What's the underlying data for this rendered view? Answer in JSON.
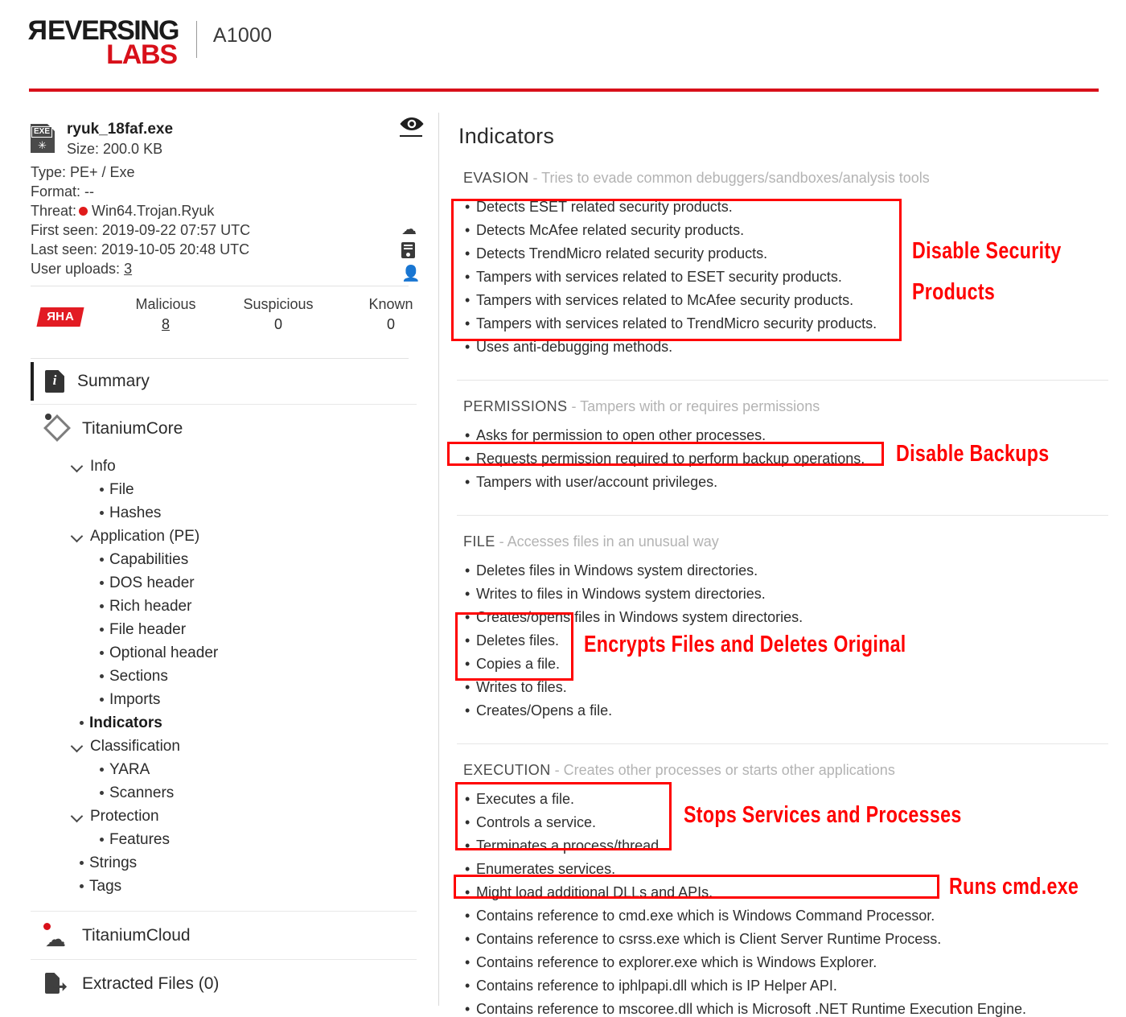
{
  "header": {
    "brand_primary": "REVERSING",
    "brand_secondary": "LABS",
    "product": "A1000",
    "accent_color": "#D8101A"
  },
  "file": {
    "name": "ryuk_18faf.exe",
    "size": "Size: 200.0 KB",
    "icon_label": "EXE",
    "type": "Type: PE+ / Exe",
    "format": "Format: --",
    "threat_label": "Threat:",
    "threat_value": "Win64.Trojan.Ryuk",
    "threat_color": "#E01B1B",
    "first_seen": "First seen: 2019-09-22 07:57 UTC",
    "last_seen": "Last seen: 2019-10-05 20:48 UTC",
    "user_uploads_label": "User uploads:",
    "user_uploads_value": "3"
  },
  "rha": {
    "badge": "RHA",
    "stats": [
      {
        "label": "Malicious",
        "value": "8",
        "link": true
      },
      {
        "label": "Suspicious",
        "value": "0",
        "link": false
      },
      {
        "label": "Known",
        "value": "0",
        "link": false
      }
    ]
  },
  "nav": {
    "summary": "Summary",
    "core": "TitaniumCore",
    "tree": [
      {
        "type": "group",
        "label": "Info"
      },
      {
        "type": "leaf",
        "label": "File",
        "level": 2
      },
      {
        "type": "leaf",
        "label": "Hashes",
        "level": 2
      },
      {
        "type": "group",
        "label": "Application (PE)"
      },
      {
        "type": "leaf",
        "label": "Capabilities",
        "level": 2
      },
      {
        "type": "leaf",
        "label": "DOS header",
        "level": 2
      },
      {
        "type": "leaf",
        "label": "Rich header",
        "level": 2
      },
      {
        "type": "leaf",
        "label": "File header",
        "level": 2
      },
      {
        "type": "leaf",
        "label": "Optional header",
        "level": 2
      },
      {
        "type": "leaf",
        "label": "Sections",
        "level": 2
      },
      {
        "type": "leaf",
        "label": "Imports",
        "level": 2
      },
      {
        "type": "leaf",
        "label": "Indicators",
        "level": 1,
        "active": true
      },
      {
        "type": "group",
        "label": "Classification"
      },
      {
        "type": "leaf",
        "label": "YARA",
        "level": 2
      },
      {
        "type": "leaf",
        "label": "Scanners",
        "level": 2
      },
      {
        "type": "group",
        "label": "Protection"
      },
      {
        "type": "leaf",
        "label": "Features",
        "level": 2
      },
      {
        "type": "leaf",
        "label": "Strings",
        "level": 1
      },
      {
        "type": "leaf",
        "label": "Tags",
        "level": 1
      }
    ],
    "cloud": "TitaniumCloud",
    "extracted": "Extracted Files (0)"
  },
  "main": {
    "title": "Indicators",
    "sections": [
      {
        "name": "EVASION",
        "desc": " - Tries to evade common debuggers/sandboxes/analysis tools",
        "items": [
          "Detects ESET related security products.",
          "Detects McAfee related security products.",
          "Detects TrendMicro related security products.",
          "Tampers with services related to ESET security products.",
          "Tampers with services related to McAfee security products.",
          "Tampers with services related to TrendMicro security products.",
          "Uses anti-debugging methods."
        ]
      },
      {
        "name": "PERMISSIONS",
        "desc": " - Tampers with or requires permissions",
        "items": [
          "Asks for permission to open other processes.",
          "Requests permission required to perform backup operations.",
          "Tampers with user/account privileges."
        ]
      },
      {
        "name": "FILE",
        "desc": " - Accesses files in an unusual way",
        "items": [
          "Deletes files in Windows system directories.",
          "Writes to files in Windows system directories.",
          "Creates/opens files in Windows system directories.",
          "Deletes files.",
          "Copies a file.",
          "Writes to files.",
          "Creates/Opens a file."
        ]
      },
      {
        "name": "EXECUTION",
        "desc": " - Creates other processes or starts other applications",
        "items": [
          "Executes a file.",
          "Controls a service.",
          "Terminates a process/thread.",
          "Enumerates services.",
          "Might load additional DLLs and APIs.",
          "Contains reference to cmd.exe which is Windows Command Processor.",
          "Contains reference to csrss.exe which is Client Server Runtime Process.",
          "Contains reference to explorer.exe which is Windows Explorer.",
          "Contains reference to iphlpapi.dll which is IP Helper API.",
          "Contains reference to mscoree.dll which is Microsoft .NET Runtime Execution Engine."
        ]
      }
    ]
  },
  "annotations": {
    "color": "#FF0000",
    "labels": [
      "Disable Security\nProducts",
      "Disable Backups",
      "Encrypts Files and Deletes Original",
      "Stops Services and Processes",
      "Runs cmd.exe"
    ]
  }
}
